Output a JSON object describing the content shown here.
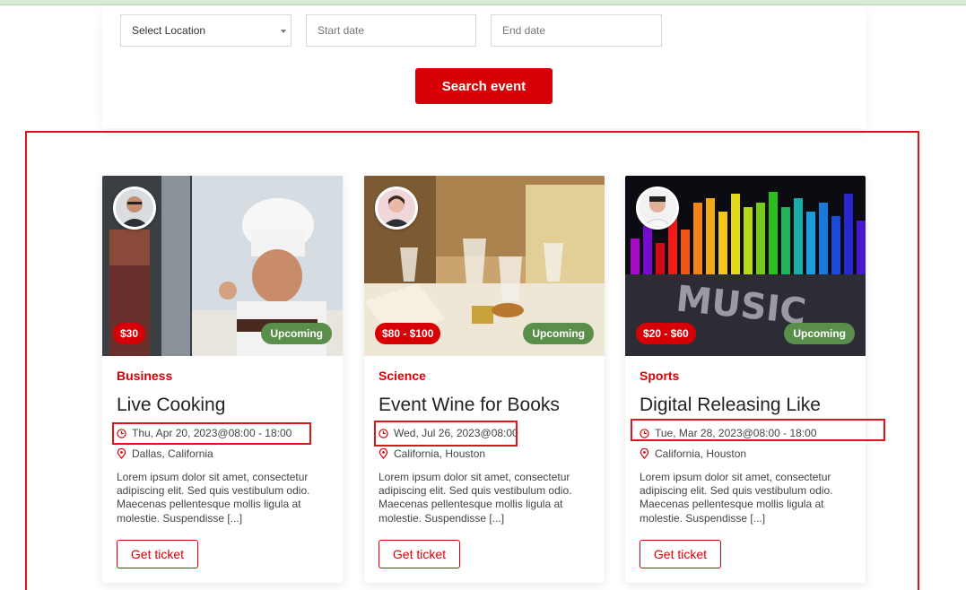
{
  "search": {
    "location_placeholder": "Select Location",
    "start_date_placeholder": "Start date",
    "end_date_placeholder": "End date",
    "button_label": "Search event"
  },
  "colors": {
    "accent": "#d80007",
    "status_green": "#5a8f4b",
    "highlight": "#e0151b"
  },
  "events": [
    {
      "price": "$30",
      "status": "Upcoming",
      "category": "Business",
      "title": "Live Cooking",
      "date": "Thu, Apr 20, 2023@08:00 - 18:00",
      "location": "Dallas, California",
      "description": "Lorem ipsum dolor sit amet, consectetur adipiscing elit. Sed quis vestibulum odio. Maecenas pellentesque mollis ligula at molestie. Suspendisse [...]",
      "button": "Get ticket"
    },
    {
      "price": "$80 - $100",
      "status": "Upcoming",
      "category": "Science",
      "title": "Event Wine for Books",
      "date": "Wed, Jul 26, 2023@08:00",
      "location": "California, Houston",
      "description": "Lorem ipsum dolor sit amet, consectetur adipiscing elit. Sed quis vestibulum odio. Maecenas pellentesque mollis ligula at molestie. Suspendisse [...]",
      "button": "Get ticket"
    },
    {
      "price": "$20 - $60",
      "status": "Upcoming",
      "category": "Sports",
      "title": "Digital Releasing Like",
      "date": "Tue, Mar 28, 2023@08:00 - 18:00",
      "location": "California, Houston",
      "description": "Lorem ipsum dolor sit amet, consectetur adipiscing elit. Sed quis vestibulum odio. Maecenas pellentesque mollis ligula at molestie. Suspendisse [...]",
      "button": "Get ticket"
    }
  ]
}
